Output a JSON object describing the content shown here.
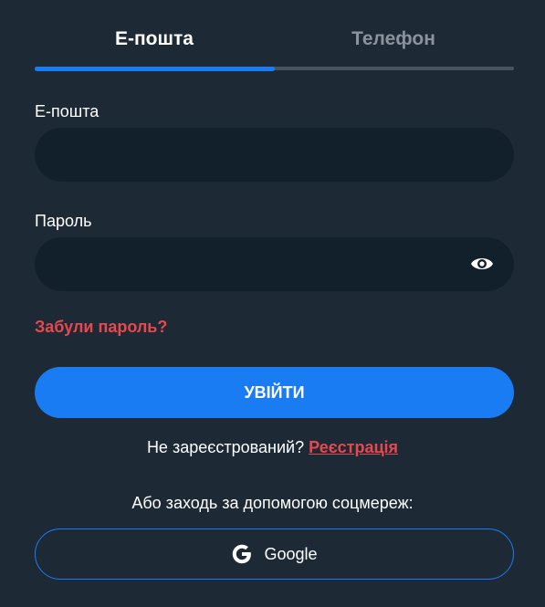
{
  "tabs": {
    "email": "Е-пошта",
    "phone": "Телефон",
    "active": "email"
  },
  "form": {
    "email_label": "Е-пошта",
    "email_value": "",
    "password_label": "Пароль",
    "password_value": "",
    "password_toggle_icon": "eye-icon",
    "forgot_password": "Забули пароль?",
    "submit_label": "УВІЙТИ"
  },
  "register": {
    "prompt": "Не зареєстрований?",
    "link": "Реєстрація"
  },
  "social": {
    "caption": "Або заходь за допомогою соцмереж:",
    "google_label": "Google",
    "google_icon": "google-icon"
  },
  "colors": {
    "background": "#1d2a36",
    "input_background": "#12202c",
    "accent": "#1a7cf3",
    "link_red": "#e5484d",
    "inactive_tab": "#8a939b"
  }
}
